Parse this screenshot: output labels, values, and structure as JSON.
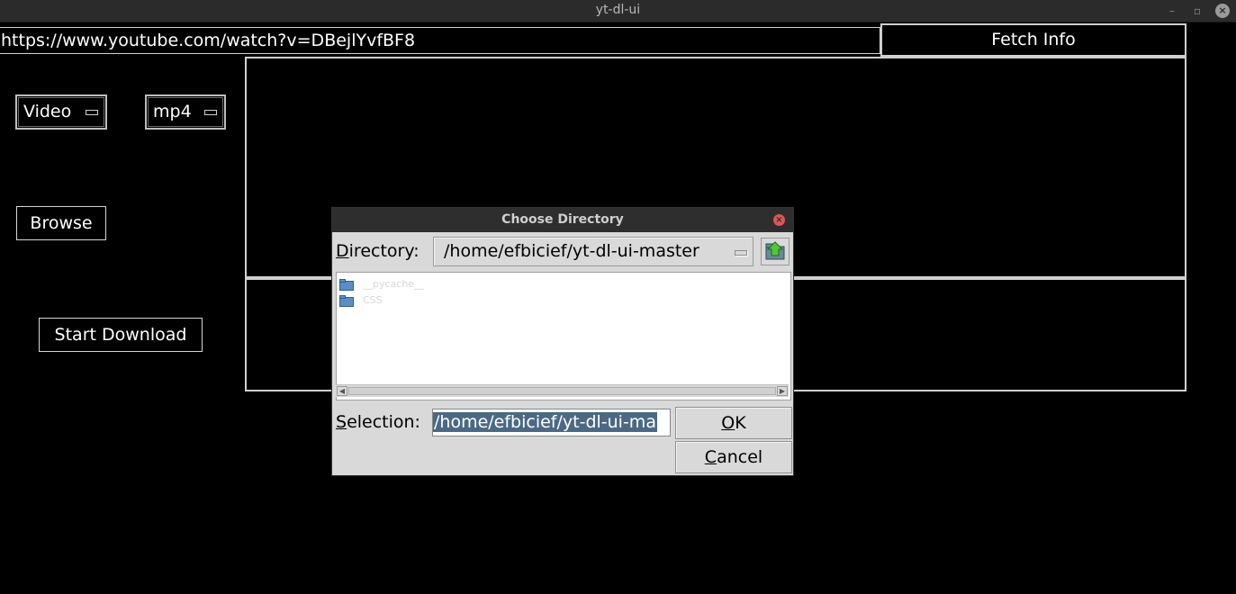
{
  "window": {
    "title": "yt-dl-ui",
    "minimize_label": "–",
    "restore_label": "▫",
    "close_label": "×"
  },
  "main": {
    "url_value": "https://www.youtube.com/watch?v=DBejlYvfBF8",
    "fetch_button": "Fetch Info",
    "type_select": "Video",
    "format_select": "mp4",
    "browse_button": "Browse",
    "start_button": "Start Download"
  },
  "dialog": {
    "title": "Choose Directory",
    "close_label": "×",
    "directory_label_mnemonic": "D",
    "directory_label_rest": "irectory:",
    "directory_value": "/home/efbicief/yt-dl-ui-master",
    "folders": [
      "__pycache__",
      "CSS"
    ],
    "selection_label_mnemonic": "S",
    "selection_label_rest": "election:",
    "selection_value": "/home/efbicief/yt-dl-ui-ma",
    "ok_mnemonic": "O",
    "ok_rest": "K",
    "cancel_mnemonic": "C",
    "cancel_rest": "ancel",
    "scroll_left": "◀",
    "scroll_right": "▶"
  },
  "colors": {
    "background": "#000000",
    "dialog_bg": "#d9d9d9",
    "selection_highlight": "#4a6984",
    "dialog_close": "#e05555"
  },
  "icons": [
    "folder-icon",
    "folder-up-icon",
    "close-icon"
  ]
}
